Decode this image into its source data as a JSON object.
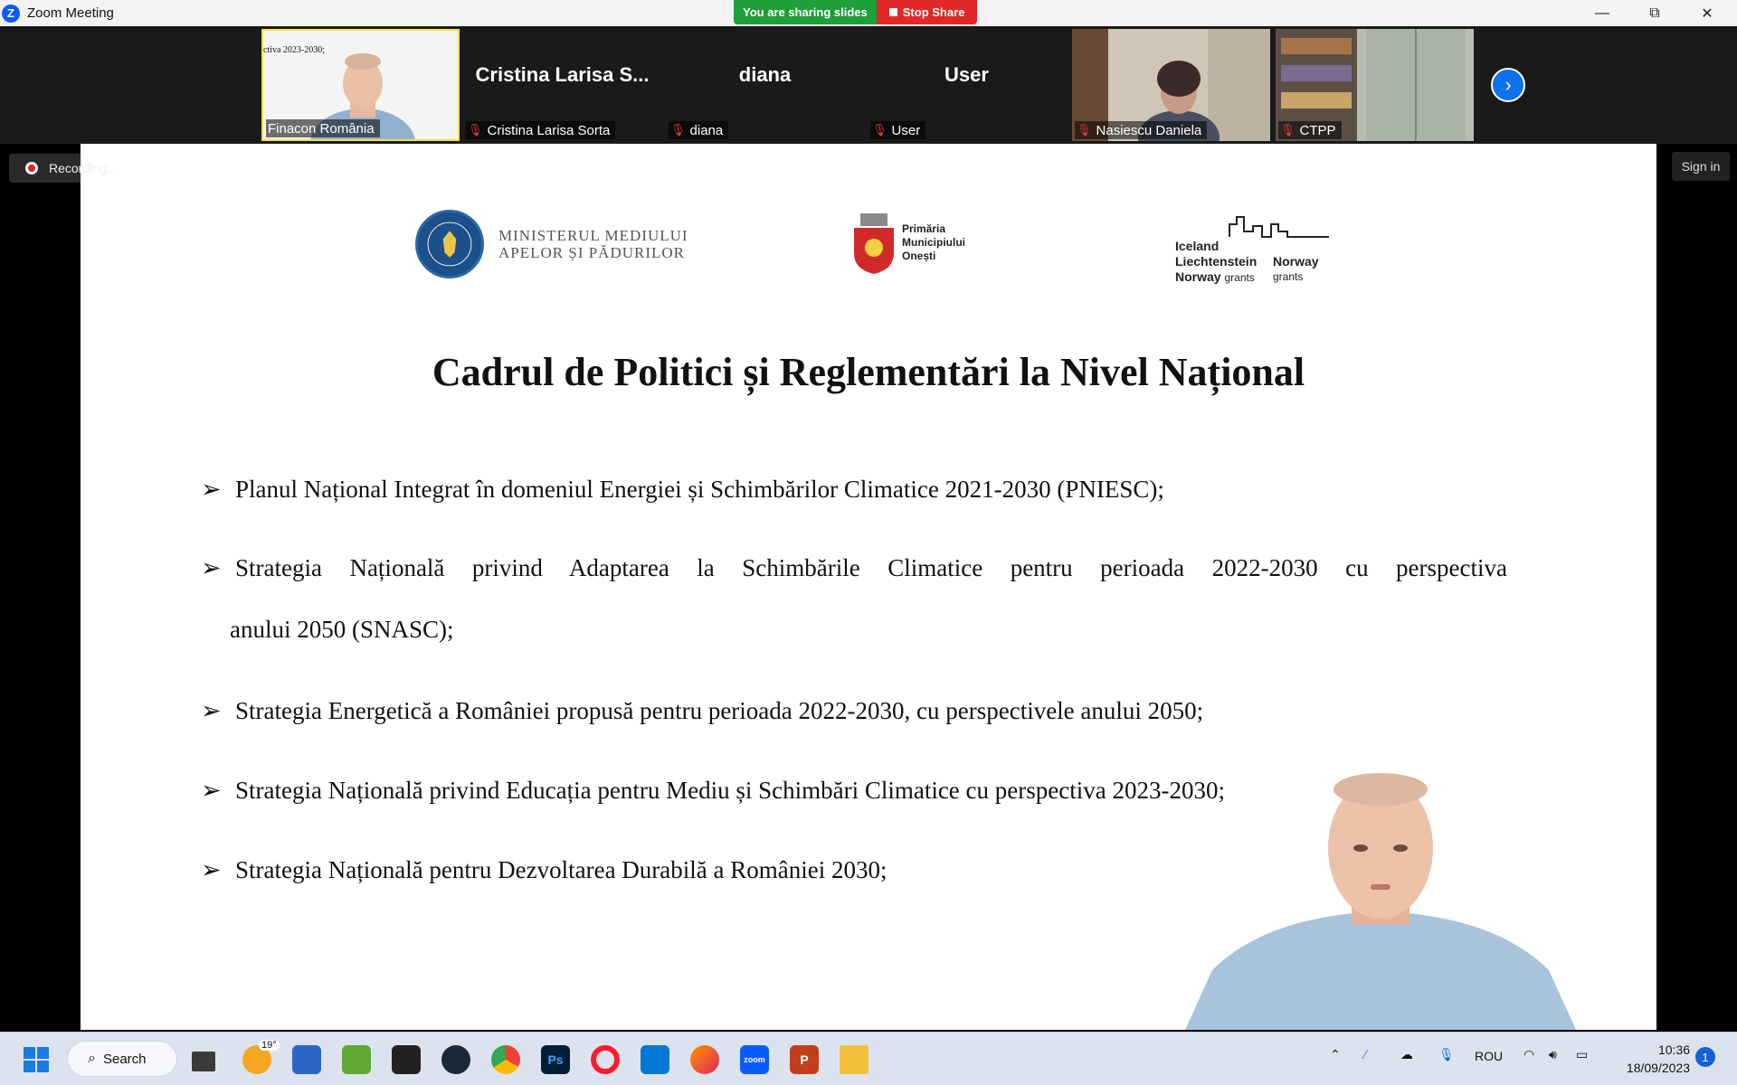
{
  "window": {
    "app_icon": "zoom-icon",
    "title": "Zoom Meeting",
    "sharing_status": "You are sharing slides",
    "stop_share_label": "Stop Share"
  },
  "participants": [
    {
      "name": "Finacon România",
      "thumb_caption": "ctiva 2023-2030;",
      "has_video": true,
      "muted": false
    },
    {
      "name": "Cristina Larisa Sorta",
      "display": "Cristina Larisa S...",
      "has_video": false,
      "muted": true
    },
    {
      "name": "diana",
      "display": "diana",
      "has_video": false,
      "muted": true
    },
    {
      "name": "User",
      "display": "User",
      "has_video": false,
      "muted": true
    },
    {
      "name": "Nasiescu Daniela",
      "has_video": true,
      "muted": true
    },
    {
      "name": "CTPP",
      "has_video": true,
      "muted": true
    }
  ],
  "recording": {
    "label": "Recording..."
  },
  "signin": {
    "label": "Sign in"
  },
  "slide": {
    "logos": {
      "ministry": {
        "line1": "MINISTERUL MEDIULUI",
        "line2": "APELOR ȘI PĂDURILOR",
        "seal": "GUVERNUL ROMÂNIEI"
      },
      "primaria": {
        "line1": "Primăria",
        "line2": "Municipiului",
        "line3": "Onești"
      },
      "eea": {
        "line1": "Iceland",
        "line2": "Liechtenstein",
        "line3": "Norway",
        "grants1": "grants",
        "norway": "Norway",
        "grants2": "grants"
      }
    },
    "title": "Cadrul de Politici și Reglementări la Nivel Național",
    "bullets": [
      "Planul Național Integrat în domeniul Energiei și Schimbărilor Climatice 2021-2030 (PNIESC);",
      "Strategia Națională privind Adaptarea la Schimbările Climatice pentru perioada 2022-2030 cu perspectiva",
      "Strategia Energetică a României propusă pentru perioada 2022-2030, cu perspectivele anului 2050;",
      "Strategia Națională privind Educația pentru Mediu și Schimbări Climatice cu perspectiva 2023-2030;",
      "Strategia Națională pentru Dezvoltarea Durabilă a României 2030;"
    ],
    "bullet2_continuation": "anului 2050 (SNASC);"
  },
  "taskbar": {
    "search_label": "Search",
    "weather_temp": "19°",
    "language": "ROU",
    "time": "10:36",
    "date": "18/09/2023",
    "notification_count": "1",
    "apps": [
      "start-icon",
      "task-view-icon",
      "weather-icon",
      "store-icon",
      "nvidia-icon",
      "nvidia-icon",
      "steam-icon",
      "chrome-icon",
      "photoshop-icon",
      "opera-icon",
      "vscode-icon",
      "firefox-icon",
      "zoom-icon",
      "powerpoint-icon",
      "file-explorer-icon"
    ]
  },
  "colors": {
    "share_green": "#1f9e39",
    "stop_red": "#e02828",
    "zoom_blue": "#0b5cff",
    "active_border": "#f6e04b"
  }
}
